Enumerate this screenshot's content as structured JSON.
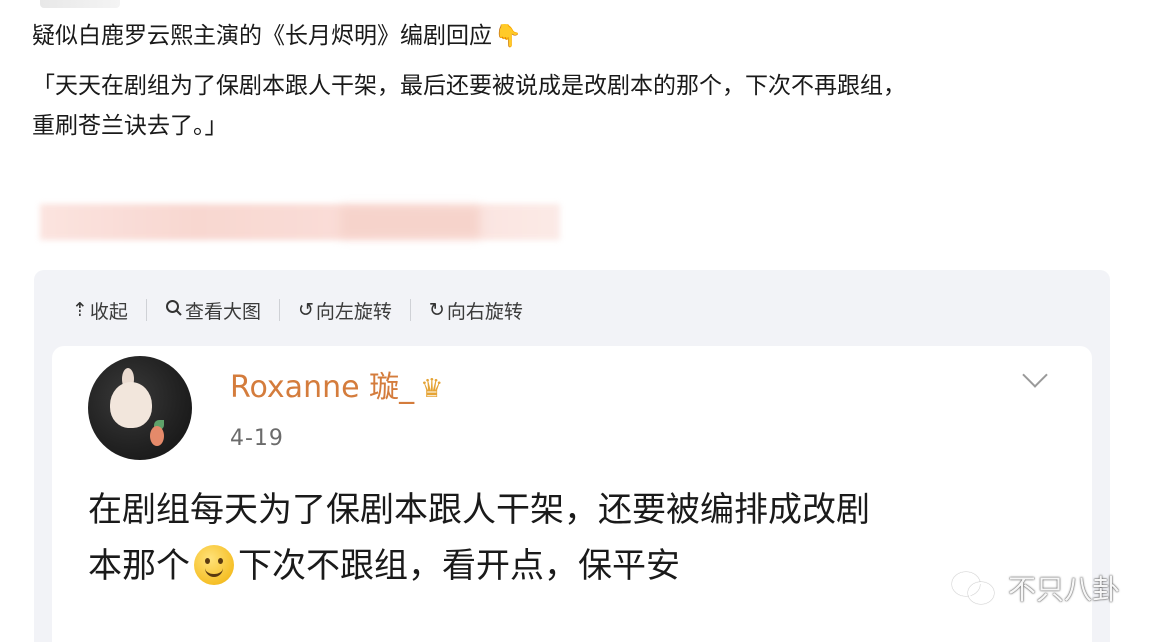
{
  "post": {
    "title": "疑似白鹿罗云熙主演的《长月烬明》编剧回应",
    "finger_icon": "pointing-down-hand",
    "body_line1": "「天天在剧组为了保剧本跟人干架，最后还要被说成是改剧本的那个，下次不再跟组，",
    "body_line2": "重刷苍兰诀去了。」"
  },
  "toolbar": {
    "collapse_label": "收起",
    "collapse_icon": "↥",
    "view_large_label": "查看大图",
    "view_large_icon": "magnifier",
    "rotate_left_label": "向左旋转",
    "rotate_left_icon": "rotate-ccw",
    "rotate_right_label": "向右旋转",
    "rotate_right_icon": "rotate-cw"
  },
  "card": {
    "username": "Roxanne 璇_",
    "badge_icon": "crown",
    "date": "4-19",
    "text_line1": "在剧组每天为了保剧本跟人干架，还要被编排成改剧",
    "text_line2_before": "本那个",
    "text_line2_after": "下次不跟组，看开点，保平安"
  },
  "watermark": {
    "text": "不只八卦"
  },
  "colors": {
    "username": "#d47c3c",
    "panel_bg": "#f2f3f7",
    "blur_strip": "#f8d3cc"
  }
}
